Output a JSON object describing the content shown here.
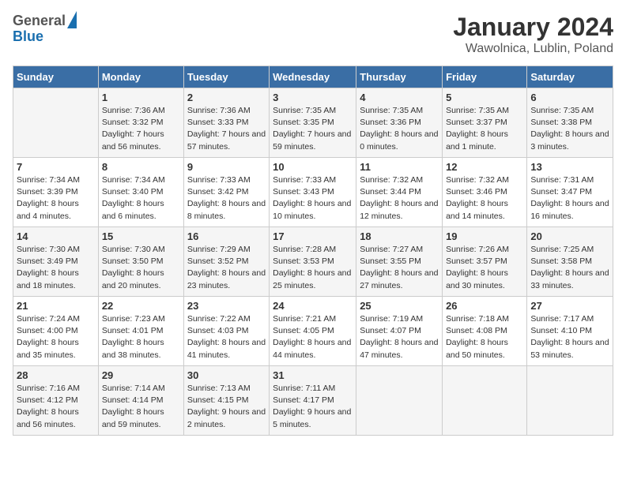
{
  "logo": {
    "general": "General",
    "blue": "Blue"
  },
  "title": "January 2024",
  "subtitle": "Wawolnica, Lublin, Poland",
  "headers": [
    "Sunday",
    "Monday",
    "Tuesday",
    "Wednesday",
    "Thursday",
    "Friday",
    "Saturday"
  ],
  "weeks": [
    [
      {
        "day": "",
        "sunrise": "",
        "sunset": "",
        "daylight": ""
      },
      {
        "day": "1",
        "sunrise": "Sunrise: 7:36 AM",
        "sunset": "Sunset: 3:32 PM",
        "daylight": "Daylight: 7 hours and 56 minutes."
      },
      {
        "day": "2",
        "sunrise": "Sunrise: 7:36 AM",
        "sunset": "Sunset: 3:33 PM",
        "daylight": "Daylight: 7 hours and 57 minutes."
      },
      {
        "day": "3",
        "sunrise": "Sunrise: 7:35 AM",
        "sunset": "Sunset: 3:35 PM",
        "daylight": "Daylight: 7 hours and 59 minutes."
      },
      {
        "day": "4",
        "sunrise": "Sunrise: 7:35 AM",
        "sunset": "Sunset: 3:36 PM",
        "daylight": "Daylight: 8 hours and 0 minutes."
      },
      {
        "day": "5",
        "sunrise": "Sunrise: 7:35 AM",
        "sunset": "Sunset: 3:37 PM",
        "daylight": "Daylight: 8 hours and 1 minute."
      },
      {
        "day": "6",
        "sunrise": "Sunrise: 7:35 AM",
        "sunset": "Sunset: 3:38 PM",
        "daylight": "Daylight: 8 hours and 3 minutes."
      }
    ],
    [
      {
        "day": "7",
        "sunrise": "Sunrise: 7:34 AM",
        "sunset": "Sunset: 3:39 PM",
        "daylight": "Daylight: 8 hours and 4 minutes."
      },
      {
        "day": "8",
        "sunrise": "Sunrise: 7:34 AM",
        "sunset": "Sunset: 3:40 PM",
        "daylight": "Daylight: 8 hours and 6 minutes."
      },
      {
        "day": "9",
        "sunrise": "Sunrise: 7:33 AM",
        "sunset": "Sunset: 3:42 PM",
        "daylight": "Daylight: 8 hours and 8 minutes."
      },
      {
        "day": "10",
        "sunrise": "Sunrise: 7:33 AM",
        "sunset": "Sunset: 3:43 PM",
        "daylight": "Daylight: 8 hours and 10 minutes."
      },
      {
        "day": "11",
        "sunrise": "Sunrise: 7:32 AM",
        "sunset": "Sunset: 3:44 PM",
        "daylight": "Daylight: 8 hours and 12 minutes."
      },
      {
        "day": "12",
        "sunrise": "Sunrise: 7:32 AM",
        "sunset": "Sunset: 3:46 PM",
        "daylight": "Daylight: 8 hours and 14 minutes."
      },
      {
        "day": "13",
        "sunrise": "Sunrise: 7:31 AM",
        "sunset": "Sunset: 3:47 PM",
        "daylight": "Daylight: 8 hours and 16 minutes."
      }
    ],
    [
      {
        "day": "14",
        "sunrise": "Sunrise: 7:30 AM",
        "sunset": "Sunset: 3:49 PM",
        "daylight": "Daylight: 8 hours and 18 minutes."
      },
      {
        "day": "15",
        "sunrise": "Sunrise: 7:30 AM",
        "sunset": "Sunset: 3:50 PM",
        "daylight": "Daylight: 8 hours and 20 minutes."
      },
      {
        "day": "16",
        "sunrise": "Sunrise: 7:29 AM",
        "sunset": "Sunset: 3:52 PM",
        "daylight": "Daylight: 8 hours and 23 minutes."
      },
      {
        "day": "17",
        "sunrise": "Sunrise: 7:28 AM",
        "sunset": "Sunset: 3:53 PM",
        "daylight": "Daylight: 8 hours and 25 minutes."
      },
      {
        "day": "18",
        "sunrise": "Sunrise: 7:27 AM",
        "sunset": "Sunset: 3:55 PM",
        "daylight": "Daylight: 8 hours and 27 minutes."
      },
      {
        "day": "19",
        "sunrise": "Sunrise: 7:26 AM",
        "sunset": "Sunset: 3:57 PM",
        "daylight": "Daylight: 8 hours and 30 minutes."
      },
      {
        "day": "20",
        "sunrise": "Sunrise: 7:25 AM",
        "sunset": "Sunset: 3:58 PM",
        "daylight": "Daylight: 8 hours and 33 minutes."
      }
    ],
    [
      {
        "day": "21",
        "sunrise": "Sunrise: 7:24 AM",
        "sunset": "Sunset: 4:00 PM",
        "daylight": "Daylight: 8 hours and 35 minutes."
      },
      {
        "day": "22",
        "sunrise": "Sunrise: 7:23 AM",
        "sunset": "Sunset: 4:01 PM",
        "daylight": "Daylight: 8 hours and 38 minutes."
      },
      {
        "day": "23",
        "sunrise": "Sunrise: 7:22 AM",
        "sunset": "Sunset: 4:03 PM",
        "daylight": "Daylight: 8 hours and 41 minutes."
      },
      {
        "day": "24",
        "sunrise": "Sunrise: 7:21 AM",
        "sunset": "Sunset: 4:05 PM",
        "daylight": "Daylight: 8 hours and 44 minutes."
      },
      {
        "day": "25",
        "sunrise": "Sunrise: 7:19 AM",
        "sunset": "Sunset: 4:07 PM",
        "daylight": "Daylight: 8 hours and 47 minutes."
      },
      {
        "day": "26",
        "sunrise": "Sunrise: 7:18 AM",
        "sunset": "Sunset: 4:08 PM",
        "daylight": "Daylight: 8 hours and 50 minutes."
      },
      {
        "day": "27",
        "sunrise": "Sunrise: 7:17 AM",
        "sunset": "Sunset: 4:10 PM",
        "daylight": "Daylight: 8 hours and 53 minutes."
      }
    ],
    [
      {
        "day": "28",
        "sunrise": "Sunrise: 7:16 AM",
        "sunset": "Sunset: 4:12 PM",
        "daylight": "Daylight: 8 hours and 56 minutes."
      },
      {
        "day": "29",
        "sunrise": "Sunrise: 7:14 AM",
        "sunset": "Sunset: 4:14 PM",
        "daylight": "Daylight: 8 hours and 59 minutes."
      },
      {
        "day": "30",
        "sunrise": "Sunrise: 7:13 AM",
        "sunset": "Sunset: 4:15 PM",
        "daylight": "Daylight: 9 hours and 2 minutes."
      },
      {
        "day": "31",
        "sunrise": "Sunrise: 7:11 AM",
        "sunset": "Sunset: 4:17 PM",
        "daylight": "Daylight: 9 hours and 5 minutes."
      },
      {
        "day": "",
        "sunrise": "",
        "sunset": "",
        "daylight": ""
      },
      {
        "day": "",
        "sunrise": "",
        "sunset": "",
        "daylight": ""
      },
      {
        "day": "",
        "sunrise": "",
        "sunset": "",
        "daylight": ""
      }
    ]
  ]
}
